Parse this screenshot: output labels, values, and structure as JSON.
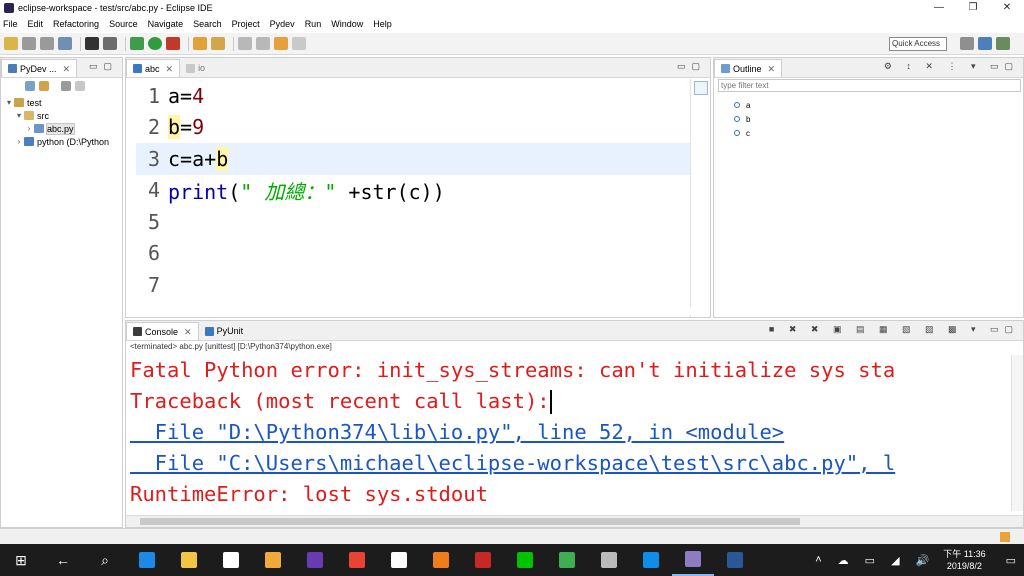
{
  "window": {
    "title": "eclipse-workspace - test/src/abc.py - Eclipse IDE",
    "controls": [
      "—",
      "❐",
      "✕"
    ]
  },
  "menu": [
    "File",
    "Edit",
    "Refactoring",
    "Source",
    "Navigate",
    "Search",
    "Project",
    "Pydev",
    "Run",
    "Window",
    "Help"
  ],
  "toolbar": {
    "quick_access": "Quick Access"
  },
  "package_explorer": {
    "tab_label": "PyDev ...",
    "tree": [
      {
        "label": "test",
        "twisty": "▾",
        "indent": 0,
        "icon": "project-icon"
      },
      {
        "label": "src",
        "twisty": "▾",
        "indent": 1,
        "icon": "source-folder-icon"
      },
      {
        "label": "abc.py",
        "twisty": "›",
        "indent": 2,
        "icon": "python-file-icon",
        "selected": true
      },
      {
        "label": "python  (D:\\Python",
        "twisty": "›",
        "indent": 1,
        "icon": "python-interpreter-icon"
      }
    ]
  },
  "editor": {
    "tabs": [
      {
        "label": "abc",
        "active": true
      },
      {
        "label": "io",
        "active": false
      }
    ],
    "lines": [
      {
        "n": "1",
        "tokens": [
          [
            "a",
            ""
          ],
          [
            "=",
            ""
          ],
          [
            "4",
            "num"
          ]
        ]
      },
      {
        "n": "2",
        "tokens": [
          [
            "b",
            "hl"
          ],
          [
            "=",
            ""
          ],
          [
            "9",
            "num"
          ]
        ]
      },
      {
        "n": "3",
        "tokens": [
          [
            "c",
            ""
          ],
          [
            "=",
            ""
          ],
          [
            "a",
            ""
          ],
          [
            "+",
            ""
          ],
          [
            "b",
            "hl"
          ]
        ],
        "current": true
      },
      {
        "n": "4",
        "tokens": [
          [
            "print",
            "kw"
          ],
          [
            "(",
            ""
          ],
          [
            "\" 加總：\"",
            "str"
          ],
          [
            " +str(c))",
            ""
          ]
        ]
      },
      {
        "n": "5",
        "tokens": []
      },
      {
        "n": "6",
        "tokens": []
      },
      {
        "n": "7",
        "tokens": []
      }
    ]
  },
  "outline": {
    "tab_label": "Outline",
    "filter_placeholder": "type filter text",
    "items": [
      "a",
      "b",
      "c"
    ]
  },
  "console": {
    "tabs": [
      "Console",
      "PyUnit"
    ],
    "terminated_label": "<terminated> abc.py [unittest] [D:\\Python374\\python.exe]",
    "lines": [
      {
        "text": "Fatal Python error: init_sys_streams: can't initialize sys sta",
        "kind": "err"
      },
      {
        "text": "Traceback (most recent call last):",
        "kind": "err",
        "caret": true
      },
      {
        "text": "  File \"D:\\Python374\\lib\\io.py\", line 52, in <module>",
        "kind": "lnk"
      },
      {
        "text": "  File \"C:\\Users\\michael\\eclipse-workspace\\test\\src\\abc.py\", l",
        "kind": "lnk"
      },
      {
        "text": "RuntimeError: lost sys.stdout",
        "kind": "err"
      }
    ]
  },
  "taskbar": {
    "apps": [
      {
        "name": "start-icon",
        "glyph": "⊞",
        "color": "#ffffff"
      },
      {
        "name": "back-icon",
        "glyph": "←",
        "color": "#ffffff"
      },
      {
        "name": "search-icon",
        "glyph": "⌕",
        "color": "#ffffff"
      },
      {
        "name": "edge-icon",
        "glyph": "",
        "color": "#1e88e5"
      },
      {
        "name": "file-explorer-icon",
        "glyph": "",
        "color": "#f4c542"
      },
      {
        "name": "store-icon",
        "glyph": "",
        "color": "#ffffff"
      },
      {
        "name": "scratch-icon",
        "glyph": "",
        "color": "#f2a93b"
      },
      {
        "name": "visual-studio-icon",
        "glyph": "",
        "color": "#6a3ab2"
      },
      {
        "name": "chrome-icon",
        "glyph": "",
        "color": "#e94335"
      },
      {
        "name": "mail-icon",
        "glyph": "",
        "color": "#ffffff"
      },
      {
        "name": "xampp-icon",
        "glyph": "",
        "color": "#f07c1a"
      },
      {
        "name": "filezilla-icon",
        "glyph": "",
        "color": "#c62828"
      },
      {
        "name": "line-icon",
        "glyph": "",
        "color": "#00c300"
      },
      {
        "name": "kite-icon",
        "glyph": "",
        "color": "#3fae52"
      },
      {
        "name": "calculator-icon",
        "glyph": "",
        "color": "#bbbbbb"
      },
      {
        "name": "teamviewer-icon",
        "glyph": "",
        "color": "#0e8ee9"
      },
      {
        "name": "eclipse-icon",
        "glyph": "",
        "color": "#8e7cc3"
      },
      {
        "name": "word-icon",
        "glyph": "",
        "color": "#2b579a"
      }
    ],
    "tray_icons": [
      "˄",
      "☁",
      "▭",
      "◢",
      "🔊"
    ],
    "time": "下午 11:36",
    "date": "2019/8/2"
  }
}
